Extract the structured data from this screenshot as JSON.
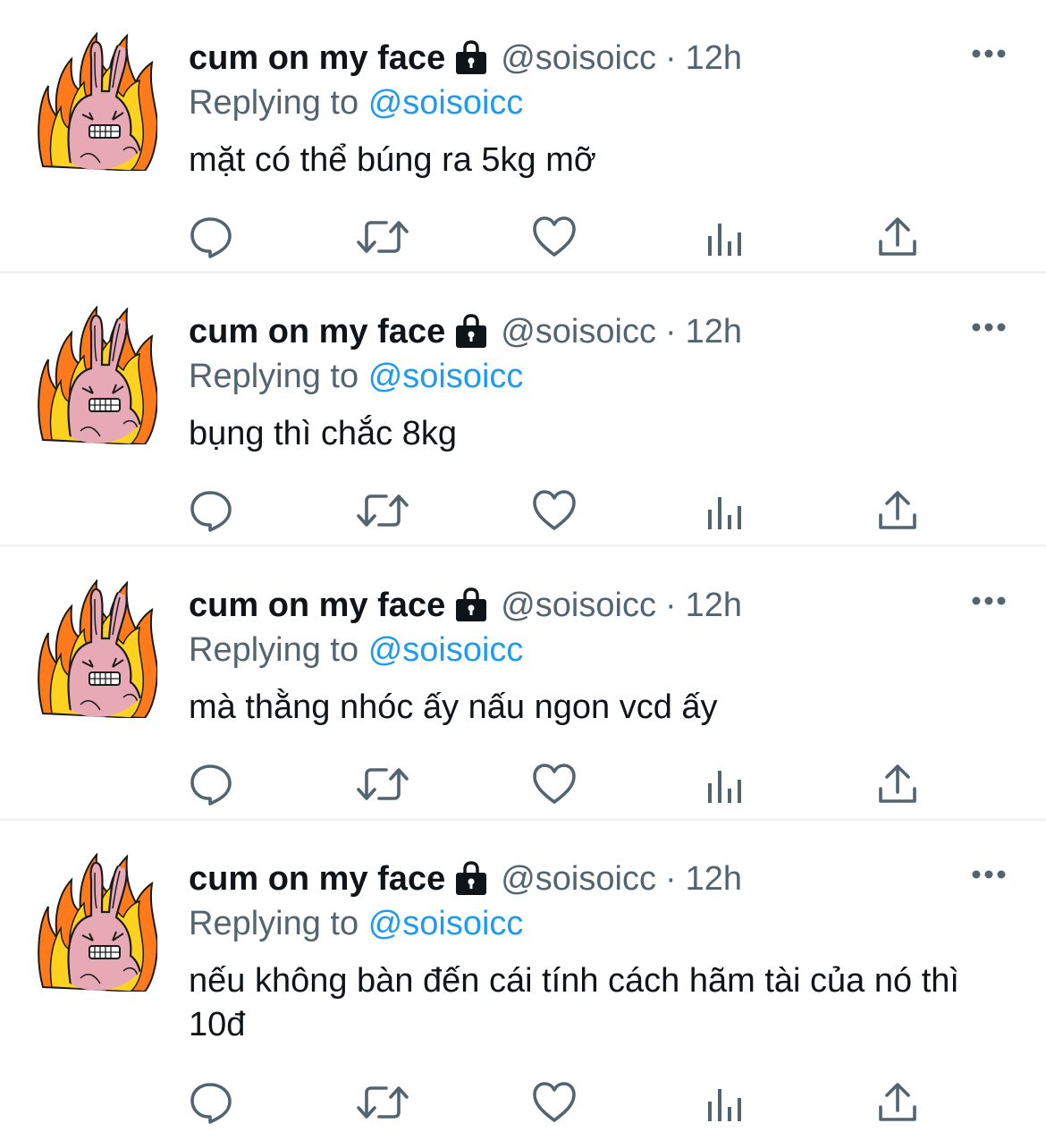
{
  "tweets": [
    {
      "display_name": "cum on my face",
      "handle": "@soisoicc",
      "separator": "·",
      "time": "12h",
      "replying_prefix": "Replying to",
      "replying_to": "@soisoicc",
      "text": "mặt có thể búng ra 5kg mỡ"
    },
    {
      "display_name": "cum on my face",
      "handle": "@soisoicc",
      "separator": "·",
      "time": "12h",
      "replying_prefix": "Replying to",
      "replying_to": "@soisoicc",
      "text": "bụng thì chắc 8kg"
    },
    {
      "display_name": "cum on my face",
      "handle": "@soisoicc",
      "separator": "·",
      "time": "12h",
      "replying_prefix": "Replying to",
      "replying_to": "@soisoicc",
      "text": "mà thằng nhóc ấy nấu ngon vcd ấy"
    },
    {
      "display_name": "cum on my face",
      "handle": "@soisoicc",
      "separator": "·",
      "time": "12h",
      "replying_prefix": "Replying to",
      "replying_to": "@soisoicc",
      "text": "nếu không bàn đến cái tính cách hãm tài của nó thì 10đ"
    }
  ],
  "icons": {
    "avatar": "bunny-on-fire-avatar",
    "lock": "lock-icon",
    "more": "more-icon",
    "actions": [
      "reply-icon",
      "retweet-icon",
      "like-icon",
      "views-icon",
      "share-icon"
    ]
  },
  "colors": {
    "text_primary": "#0f1419",
    "text_secondary": "#536471",
    "link": "#1d9bf0",
    "divider": "#eff3f4"
  }
}
